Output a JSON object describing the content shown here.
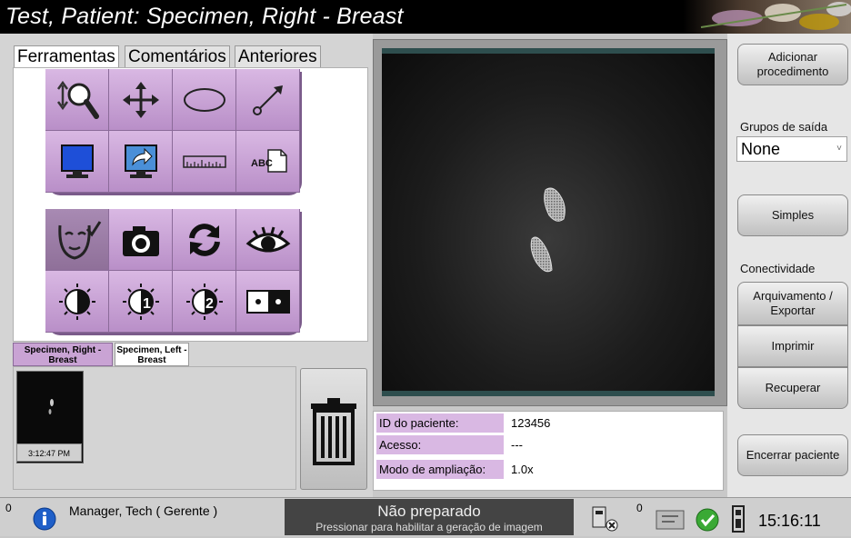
{
  "window": {
    "title": "Test, Patient:  Specimen, Right - Breast"
  },
  "tabs": {
    "tools": "Ferramentas",
    "comments": "Comentários",
    "previous": "Anteriores"
  },
  "tools_top": [
    {
      "name": "zoom-icon"
    },
    {
      "name": "pan-icon"
    },
    {
      "name": "ellipse-icon"
    },
    {
      "name": "arrow-icon"
    },
    {
      "name": "monitor-icon"
    },
    {
      "name": "send-to-monitor-icon"
    },
    {
      "name": "ruler-icon"
    },
    {
      "name": "annotation-text-icon"
    }
  ],
  "tools_bottom": [
    {
      "name": "face-check-icon"
    },
    {
      "name": "camera-icon"
    },
    {
      "name": "refresh-icon"
    },
    {
      "name": "eye-icon"
    },
    {
      "name": "contrast-icon"
    },
    {
      "name": "contrast-1-icon",
      "text": "1"
    },
    {
      "name": "contrast-2-icon",
      "text": "2"
    },
    {
      "name": "invert-icon"
    }
  ],
  "annotation_tool_text": "ABC",
  "specimen_tabs": [
    {
      "label": "Specimen, Right - Breast"
    },
    {
      "label": "Specimen, Left - Breast"
    }
  ],
  "thumbnail": {
    "time": "3:12:47 PM"
  },
  "info": {
    "patient_id_label": "ID do paciente:",
    "patient_id": "123456",
    "access_label": "Acesso:",
    "access": "---",
    "zoom_label": "Modo de ampliação:",
    "zoom": "1.0x"
  },
  "right": {
    "add_procedure": "Adicionar procedimento",
    "output_groups_label": "Grupos de saída",
    "output_group_value": "None",
    "simple": "Simples",
    "connectivity_label": "Conectividade",
    "archive_export": "Arquivamento / Exportar",
    "print": "Imprimir",
    "retrieve": "Recuperar",
    "close_patient": "Encerrar paciente"
  },
  "status": {
    "count_left": "0",
    "user": "Manager, Tech ( Gerente )",
    "not_ready": "Não preparado",
    "not_ready_hint": "Pressionar para habilitar a geração de imagem",
    "count_right": "0",
    "time": "15:16:11"
  },
  "colors": {
    "tool_purple": "#c9a3d4",
    "label_purple": "#d9b8e3",
    "titlebar": "#000000"
  }
}
